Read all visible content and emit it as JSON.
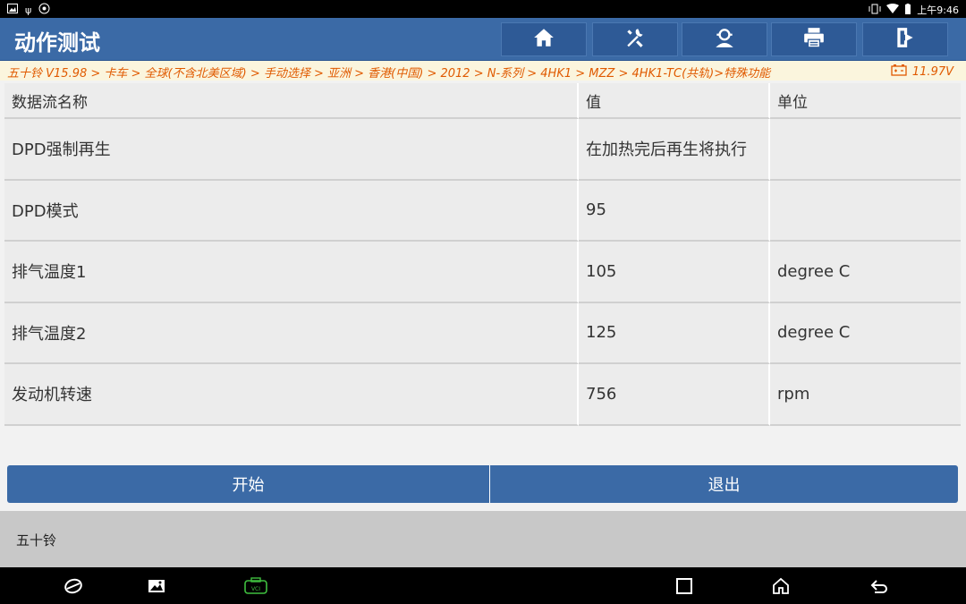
{
  "status_bar": {
    "time": "上午9:46"
  },
  "header": {
    "title": "动作测试",
    "toolbar": [
      {
        "name": "home-button",
        "icon": "home-icon"
      },
      {
        "name": "diagnose-tools-button",
        "icon": "tools-icon"
      },
      {
        "name": "user-button",
        "icon": "user-icon"
      },
      {
        "name": "print-button",
        "icon": "print-icon"
      },
      {
        "name": "exit-app-button",
        "icon": "logout-icon"
      }
    ]
  },
  "breadcrumb": {
    "path": "五十铃 V15.98 > 卡车 > 全球(不含北美区域) > 手动选择 > 亚洲 > 香港(中国) > 2012 > N-系列 > 4HK1 > MZZ > 4HK1-TC(共轨)>特殊功能",
    "voltage": "11.97V"
  },
  "table": {
    "headers": [
      "数据流名称",
      "值",
      "单位"
    ],
    "rows": [
      [
        "DPD强制再生",
        "在加热完后再生将执行",
        ""
      ],
      [
        "DPD模式",
        "95",
        ""
      ],
      [
        "排气温度1",
        "105",
        "degree C"
      ],
      [
        "排气温度2",
        "125",
        "degree C"
      ],
      [
        "发动机转速",
        "756",
        "rpm"
      ]
    ]
  },
  "actions": {
    "start": "开始",
    "exit": "退出"
  },
  "footer": {
    "text": "五十铃"
  },
  "colors": {
    "header_blue": "#3b6aa6",
    "breadcrumb_orange": "#e05a00"
  }
}
